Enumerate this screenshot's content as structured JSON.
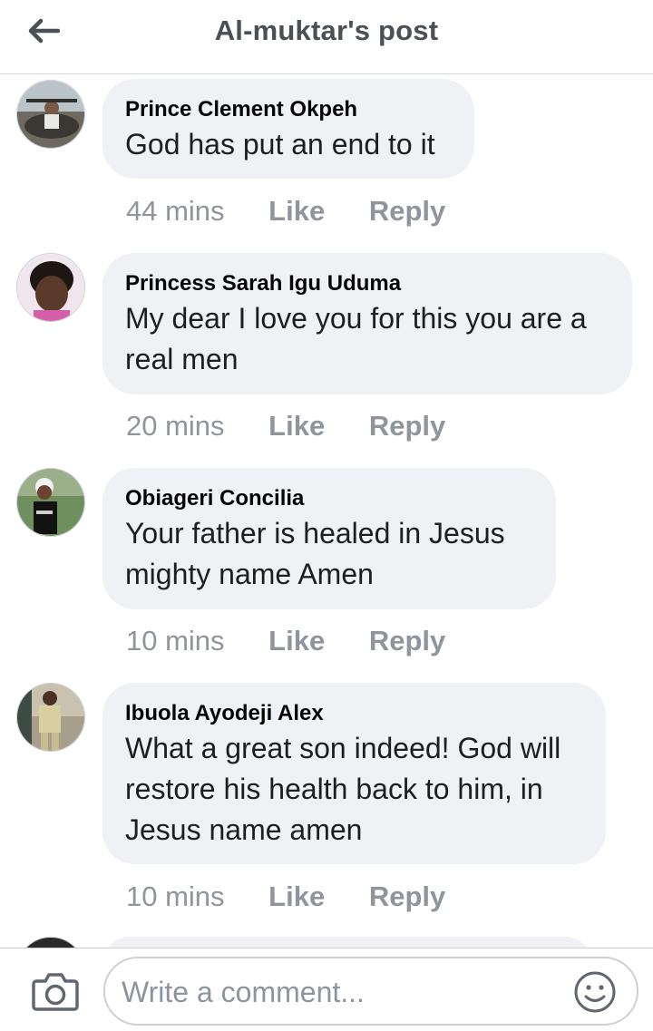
{
  "header": {
    "title": "Al-muktar's post",
    "back_icon": "arrow-left-icon"
  },
  "comments": [
    {
      "author": "Prince Clement Okpeh",
      "text": "God has put an end to it",
      "time": "44 mins",
      "like_label": "Like",
      "reply_label": "Reply"
    },
    {
      "author": "Princess Sarah Igu Uduma",
      "text": "My dear I love you for this you are a real men",
      "time": "20 mins",
      "like_label": "Like",
      "reply_label": "Reply"
    },
    {
      "author": "Obiageri Concilia",
      "text": "Your father is healed in Jesus mighty name Amen",
      "time": "10 mins",
      "like_label": "Like",
      "reply_label": "Reply"
    },
    {
      "author": "Ibuola Ayodeji Alex",
      "text": "What a great son indeed! God will restore his health back to him, in Jesus name amen",
      "time": "10 mins",
      "like_label": "Like",
      "reply_label": "Reply"
    }
  ],
  "composer": {
    "placeholder": "Write a comment...",
    "camera_icon": "camera-icon",
    "emoji_icon": "smiley-icon"
  },
  "colors": {
    "bubble": "#f0f1f4",
    "meta_text": "#90949c",
    "header_text": "#4b4f56"
  }
}
